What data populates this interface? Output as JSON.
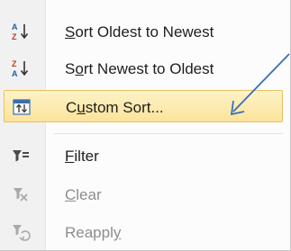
{
  "menu": {
    "items": [
      {
        "icon": "sort-ascending-az-icon",
        "pre": "",
        "key": "S",
        "post": "ort Oldest to Newest",
        "enabled": true
      },
      {
        "icon": "sort-descending-za-icon",
        "pre": "S",
        "key": "o",
        "post": "rt Newest to Oldest",
        "enabled": true
      },
      {
        "icon": "custom-sort-icon",
        "pre": "C",
        "key": "u",
        "post": "stom Sort...",
        "enabled": true,
        "highlighted": true
      },
      {
        "icon": "filter-icon",
        "pre": "",
        "key": "F",
        "post": "ilter",
        "enabled": true
      },
      {
        "icon": "clear-filter-icon",
        "pre": "",
        "key": "C",
        "post": "lear",
        "enabled": false
      },
      {
        "icon": "reapply-filter-icon",
        "pre": "Reappl",
        "key": "y",
        "post": "",
        "enabled": false
      }
    ]
  },
  "colors": {
    "highlight": "#fbe39a",
    "highlight_border": "#e8c15f",
    "annotation_arrow": "#3b6fb4",
    "disabled_text": "#8d8d8d"
  }
}
